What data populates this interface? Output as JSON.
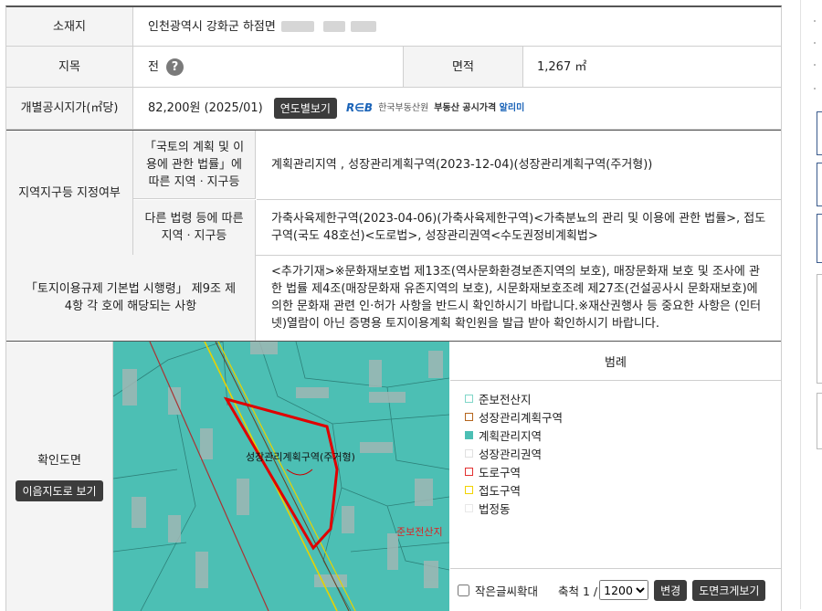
{
  "rows": {
    "location": {
      "label": "소재지",
      "value": "인천광역시 강화군 하점면"
    },
    "jimok": {
      "label": "지목",
      "value": "전",
      "help": "?"
    },
    "area": {
      "label": "면적",
      "value": "1,267 ㎡"
    },
    "price": {
      "label": "개별공시지가(㎡당)",
      "value": "82,200원 (2025/01)",
      "button": "연도별보기",
      "reb_logo": "R∈B",
      "reb_org": "한국부동산원",
      "reb_text": "부동산 공시가격",
      "reb_highlight": "알리미"
    },
    "zoning": {
      "label": "지역지구등 지정여부",
      "sub1_label": "「국토의 계획 및 이용에 관한 법률」에 따른 지역ㆍ지구등",
      "sub1_value": "계획관리지역 , 성장관리계획구역(2023-12-04)(성장관리계획구역(주거형))",
      "sub2_label": "다른 법령 등에 따른 지역ㆍ지구등",
      "sub2_value": "가축사육제한구역(2023-04-06)(가축사육제한구역)<가축분뇨의 관리 및 이용에 관한 법률>, 접도구역(국도 48호선)<도로법>, 성장관리권역<수도권정비계획법>"
    },
    "regulation": {
      "label": "「토지이용규제 기본법 시행령」 제9조 제4항 각 호에 해당되는 사항",
      "value": "<추가기재>※문화재보호법 제13조(역사문화환경보존지역의 보호), 매장문화재 보호 및 조사에 관한 법률 제4조(매장문화재 유존지역의 보호), 시문화재보호조례 제27조(건설공사시 문화재보호)에 의한 문화재 관련 인·허가 사항을 반드시 확인하시기 바랍니다.※재산권행사 등 중요한 사항은 (인터넷)열람이 아닌 증명용 토지이용계획 확인원을 발급 받아 확인하시기 바랍니다."
    },
    "map": {
      "label": "확인도면",
      "button": "이음지도로 보기",
      "map_label1": "성장관리계획구역(주거형)",
      "map_label2": "준보전산지"
    }
  },
  "legend": {
    "title": "범례",
    "items": [
      {
        "label": "준보전산지",
        "color": "#7fd6c8"
      },
      {
        "label": "성장관리계획구역",
        "color": "#b5651d"
      },
      {
        "label": "계획관리지역",
        "color": "#4cbfb4"
      },
      {
        "label": "성장관리권역",
        "color": "#e0e0e0"
      },
      {
        "label": "도로구역",
        "color": "#e23030"
      },
      {
        "label": "접도구역",
        "color": "#f2d400"
      },
      {
        "label": "법정동",
        "color": "#e8e8e8"
      }
    ]
  },
  "controls": {
    "small_text_label": "작은글씨확대",
    "scale_prefix": "축척 1 /",
    "scale_value": "1200",
    "scale_options": [
      "1200"
    ],
    "change_button": "변경",
    "large_map_button": "도면크게보기"
  },
  "colors": {
    "map_fill": "#4cbfb4",
    "parcel_border": "#e00000",
    "label_bg": "#f4f4f4"
  }
}
